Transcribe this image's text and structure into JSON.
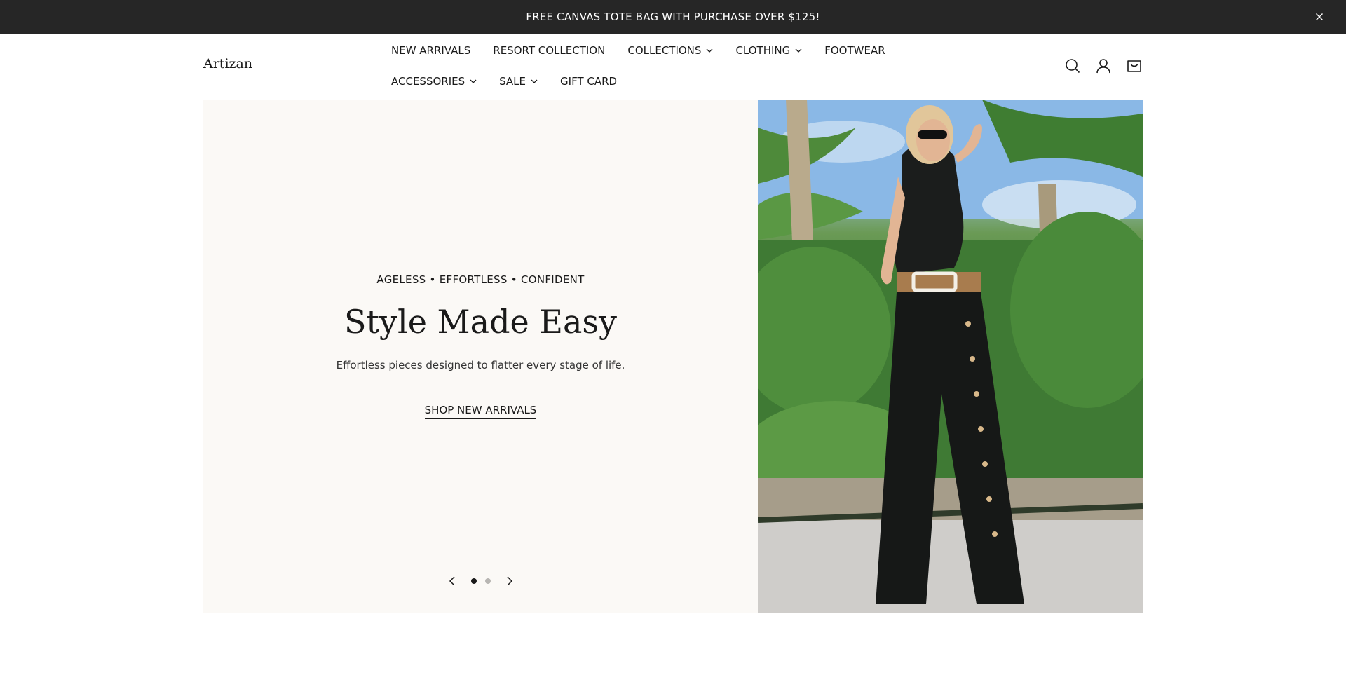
{
  "announcement": {
    "text": "FREE CANVAS TOTE BAG WITH PURCHASE OVER $125!",
    "close_icon": "close-icon"
  },
  "header": {
    "logo": "Artizan",
    "nav_row_1": [
      {
        "label": "NEW ARRIVALS",
        "has_dropdown": false
      },
      {
        "label": "RESORT COLLECTION",
        "has_dropdown": false
      },
      {
        "label": "COLLECTIONS",
        "has_dropdown": true
      },
      {
        "label": "CLOTHING",
        "has_dropdown": true
      },
      {
        "label": "FOOTWEAR",
        "has_dropdown": false
      }
    ],
    "nav_row_2": [
      {
        "label": "ACCESSORIES",
        "has_dropdown": true
      },
      {
        "label": "SALE",
        "has_dropdown": true
      },
      {
        "label": "GIFT CARD",
        "has_dropdown": false
      }
    ],
    "icons": [
      "search-icon",
      "account-icon",
      "cart-icon"
    ]
  },
  "hero": {
    "eyebrow": "AGELESS • EFFORTLESS • CONFIDENT",
    "headline": "Style Made Easy",
    "subtext": "Effortless pieces designed to flatter every stage of life.",
    "cta": "SHOP NEW ARRIVALS",
    "slides_total": 2,
    "active_slide": 1,
    "image_alt": "Woman in black top and wide-leg black pants with leopard belt, palm trees behind"
  },
  "colors": {
    "announcement_bg": "#262626",
    "hero_bg": "#fbf9f6",
    "text": "#1a1a1a"
  }
}
